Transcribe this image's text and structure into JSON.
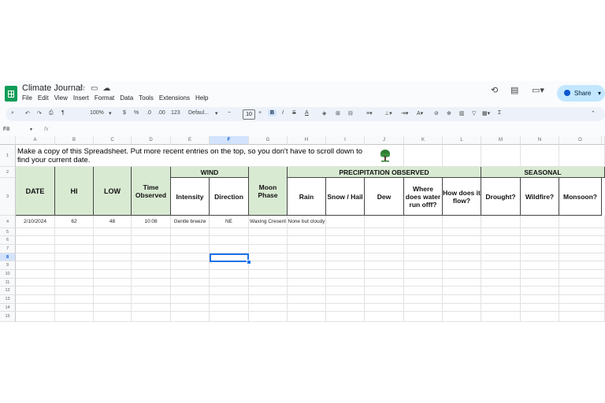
{
  "doc": {
    "title": "Climate Journal",
    "menu": [
      "File",
      "Edit",
      "View",
      "Insert",
      "Format",
      "Data",
      "Tools",
      "Extensions",
      "Help"
    ],
    "share_label": "Share"
  },
  "toolbar": {
    "zoom": "100%",
    "currency": "$",
    "percent": "%",
    "decrease_decimal": ".0",
    "increase_decimal": ".00",
    "number_format": "123",
    "font": "Defaul...",
    "font_size": "10",
    "bold": "B",
    "italic": "I",
    "text_color": "A",
    "functions": "Σ"
  },
  "formula_bar": {
    "cell_ref": "F8",
    "fx": "fx",
    "value": ""
  },
  "columns": [
    "A",
    "B",
    "C",
    "D",
    "E",
    "F",
    "G",
    "H",
    "I",
    "J",
    "K",
    "L",
    "M",
    "N",
    "O"
  ],
  "rows": [
    "1",
    "2",
    "3",
    "4",
    "5",
    "6",
    "7",
    "8",
    "9",
    "10",
    "11",
    "12",
    "13",
    "14",
    "15"
  ],
  "sheet": {
    "banner": "Make a copy of this Spreadsheet. Put more recent entries on the top, so you don't have to scroll down to find your current date.",
    "groups": {
      "wind": "WIND",
      "precip": "PRECIPITATION OBSERVED",
      "seasonal": "SEASONAL"
    },
    "headers": {
      "date": "DATE",
      "hi": "HI",
      "low": "LOW",
      "time": "Time Observed",
      "intensity": "Intensity",
      "direction": "Direction",
      "moon": "Moon Phase",
      "rain": "Rain",
      "snow": "Snow / Hail",
      "dew": "Dew",
      "runoff": "Where does water run offf?",
      "flow": "How does it flow?",
      "drought": "Drought?",
      "wildfire": "Wildfire?",
      "monsoon": "Monsoon?"
    },
    "entry": {
      "date": "2/10/2024",
      "hi": "62",
      "low": "48",
      "time": "10:08",
      "intensity": "Gentle breeze",
      "direction": "NE",
      "moon": "Waxing Cresent",
      "rain": "None but cloudy"
    }
  },
  "colors": {
    "header_green": "#d9ead3",
    "share_bg": "#c2e7ff",
    "selection": "#1a73e8"
  }
}
